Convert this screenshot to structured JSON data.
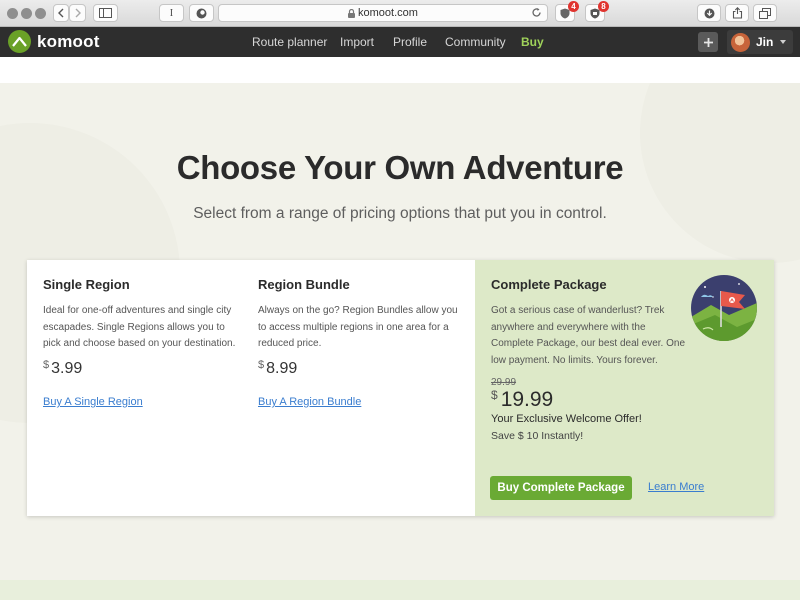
{
  "browser": {
    "url": "komoot.com",
    "extension_badges": [
      "4",
      "8"
    ],
    "reader_glyph": "I"
  },
  "nav": {
    "logo_text": "komoot",
    "links": [
      {
        "label": "Route planner",
        "active": false
      },
      {
        "label": "Import",
        "active": false
      },
      {
        "label": "Profile",
        "active": false
      },
      {
        "label": "Community",
        "active": false
      },
      {
        "label": "Buy",
        "active": true
      }
    ],
    "add_icon": "plus-icon",
    "user_name": "Jin"
  },
  "hero": {
    "title": "Choose Your Own Adventure",
    "subtitle": "Select from a range of pricing options that put you in control."
  },
  "plans": [
    {
      "name": "Single Region",
      "description": "Ideal for one-off adventures and single city escapades. Single Regions allows you to pick and choose based on your destination.",
      "currency": "$",
      "price": "3.99",
      "link": "Buy A Single Region"
    },
    {
      "name": "Region Bundle",
      "description": "Always on the go? Region Bundles allow you to access multiple regions in one area for a reduced price.",
      "currency": "$",
      "price": "8.99",
      "link": "Buy A Region Bundle"
    },
    {
      "name": "Complete Package",
      "description": "Got a serious case of wanderlust? Trek anywhere and everywhere with the Complete Package, our best deal ever. One low payment. No limits. Yours forever.",
      "old_price": "29.99",
      "currency": "$",
      "price": "19.99",
      "offer": "Your Exclusive Welcome Offer!",
      "savings": "Save $ 10 Instantly!",
      "button": "Buy Complete Package",
      "learn_more": "Learn More"
    }
  ],
  "colors": {
    "nav_bg": "#2e2e2e",
    "brand_green": "#6aa127",
    "active_nav": "#9fd25a",
    "hero_bg": "#f2f2ea",
    "highlight_panel": "#dde9c8",
    "button_green": "#6aaa34",
    "link_blue": "#3a7dcf"
  }
}
